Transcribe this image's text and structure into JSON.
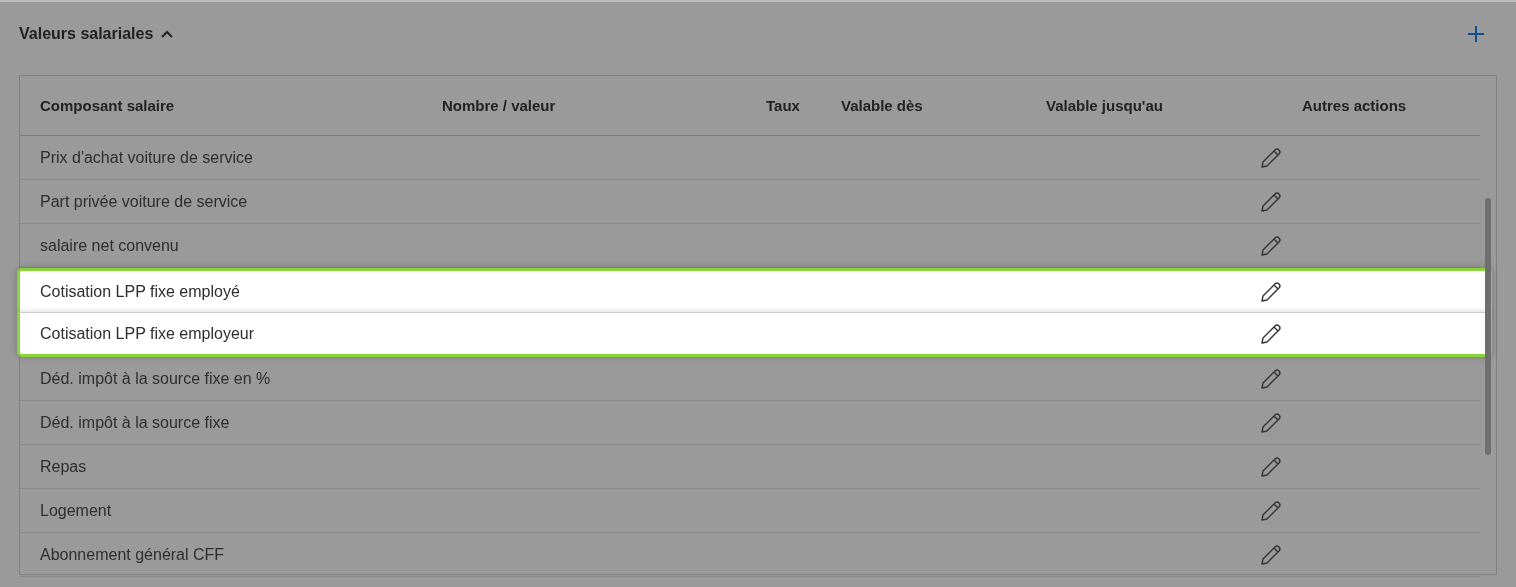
{
  "section": {
    "title": "Valeurs salariales",
    "expanded": true
  },
  "table": {
    "columns": [
      "Composant salaire",
      "Nombre / valeur",
      "Taux",
      "Valable dès",
      "Valable jusqu'au",
      "Autres actions"
    ],
    "rows": [
      {
        "composant": "Prix d'achat voiture de service",
        "highlighted": false
      },
      {
        "composant": "Part privée voiture de service",
        "highlighted": false
      },
      {
        "composant": "salaire net convenu",
        "highlighted": false
      },
      {
        "composant": "Cotisation LPP fixe employé",
        "highlighted": true
      },
      {
        "composant": "Cotisation LPP fixe employeur",
        "highlighted": true
      },
      {
        "composant": "Déd. impôt à la source fixe en %",
        "highlighted": false
      },
      {
        "composant": "Déd. impôt à la source fixe",
        "highlighted": false
      },
      {
        "composant": "Repas",
        "highlighted": false
      },
      {
        "composant": "Logement",
        "highlighted": false
      },
      {
        "composant": "Abonnement général CFF",
        "highlighted": false
      }
    ]
  }
}
